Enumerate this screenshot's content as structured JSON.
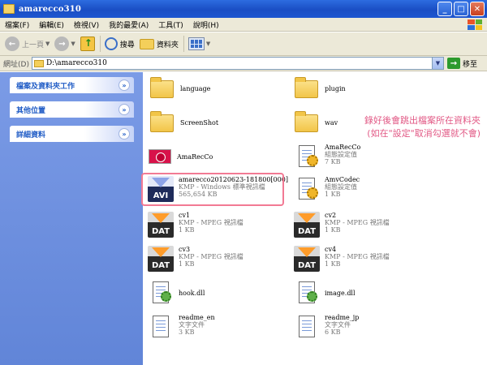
{
  "window": {
    "title": "amarecco310",
    "buttons": {
      "minimize": "_",
      "maximize": "□",
      "close": "✕"
    }
  },
  "menu": [
    "檔案(F)",
    "編輯(E)",
    "檢視(V)",
    "我的最愛(A)",
    "工具(T)",
    "說明(H)"
  ],
  "toolbar": {
    "back_label": "上一頁",
    "search_label": "搜尋",
    "folders_label": "資料夾"
  },
  "address": {
    "label": "網址(D)",
    "value": "D:\\amarecco310",
    "go_label": "移至"
  },
  "left_panel": {
    "tasks": [
      "檔案及資料夾工作",
      "其他位置",
      "詳細資料"
    ]
  },
  "items": [
    {
      "name": "language",
      "icon": "folder-icon"
    },
    {
      "name": "plugin",
      "icon": "folder-icon"
    },
    {
      "name": "ScreenShot",
      "icon": "folder-icon"
    },
    {
      "name": "wav",
      "icon": "folder-icon"
    },
    {
      "name": "AmaRecCo",
      "icon": "app-icon"
    },
    {
      "name": "AmaRecCo",
      "line2": "組態設定值",
      "line3": "7 KB",
      "icon": "config-icon"
    },
    {
      "name": "amarecco20120623-181800[000]",
      "line2": "KMP - Windows 標準視訊檔",
      "line3": "565,654 KB",
      "icon": "avi-icon",
      "tag": "AVI"
    },
    {
      "name": "AmvCodec",
      "line2": "組態設定值",
      "line3": "1 KB",
      "icon": "config-icon"
    },
    {
      "name": "cv1",
      "line2": "KMP - MPEG 視訊檔",
      "line3": "1 KB",
      "icon": "dat-icon",
      "tag": "DAT"
    },
    {
      "name": "cv2",
      "line2": "KMP - MPEG 視訊檔",
      "line3": "1 KB",
      "icon": "dat-icon",
      "tag": "DAT"
    },
    {
      "name": "cv3",
      "line2": "KMP - MPEG 視訊檔",
      "line3": "1 KB",
      "icon": "dat-icon",
      "tag": "DAT"
    },
    {
      "name": "cv4",
      "line2": "KMP - MPEG 視訊檔",
      "line3": "1 KB",
      "icon": "dat-icon",
      "tag": "DAT"
    },
    {
      "name": "hook.dll",
      "icon": "dll-icon"
    },
    {
      "name": "image.dll",
      "icon": "dll-icon"
    },
    {
      "name": "readme_en",
      "line2": "文字文件",
      "line3": "3 KB",
      "icon": "text-doc-icon"
    },
    {
      "name": "readme_jp",
      "line2": "文字文件",
      "line3": "6 KB",
      "icon": "text-doc-icon"
    }
  ],
  "annotation": {
    "line1": "錄好後會跳出檔案所在資料夾",
    "line2": "(如在\"設定\"取消勾選就不會)",
    "color": "#e25a86"
  }
}
